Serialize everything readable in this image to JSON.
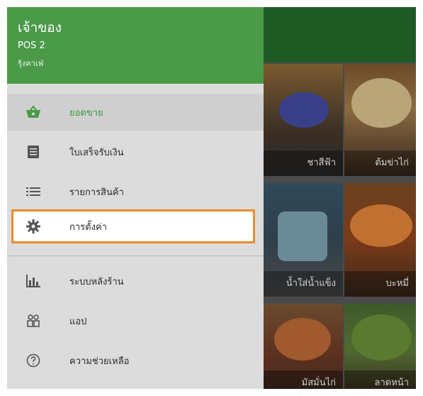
{
  "drawer": {
    "owner": "เจ้าของ",
    "pos": "POS 2",
    "shop": "รุ้งคาเฟ่",
    "items": [
      {
        "icon": "basket-icon",
        "label": "ยอดขาย",
        "active": true
      },
      {
        "icon": "receipt-icon",
        "label": "ใบเสร็จรับเงิน"
      },
      {
        "icon": "list-icon",
        "label": "รายการสินค้า"
      },
      {
        "icon": "gear-icon",
        "label": "การตั้งค่า",
        "highlighted": true
      },
      {
        "icon": "bar-chart-icon",
        "label": "ระบบหลังร้าน"
      },
      {
        "icon": "apps-icon",
        "label": "แอป"
      },
      {
        "icon": "help-icon",
        "label": "ความช่วยเหลือ"
      }
    ]
  },
  "products": {
    "tiles": [
      {
        "label": "ชาสีฟ้า"
      },
      {
        "label": "ต้มข่าไก่"
      },
      {
        "label": "น้ำใส่น้ำแข็ง"
      },
      {
        "label": "บะหมี่"
      },
      {
        "label": "มัสมั่นไก่"
      },
      {
        "label": "ลาดหน้า"
      }
    ]
  },
  "colors": {
    "accent_green": "#4a9a48",
    "highlight_orange": "#f08a2c",
    "appbar": "#1f5a25"
  }
}
